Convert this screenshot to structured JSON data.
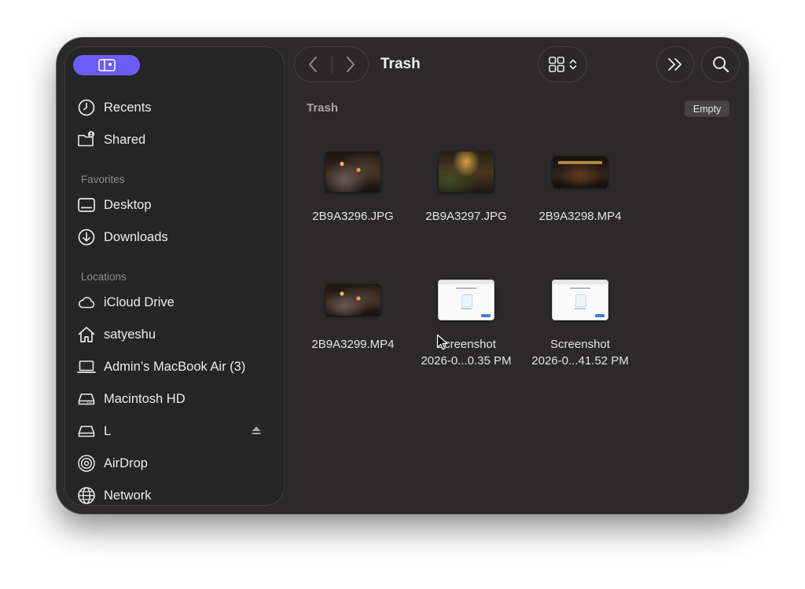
{
  "window": {
    "title": "Trash"
  },
  "sidebar": {
    "items": [
      {
        "label": "Recents",
        "icon": "clock-icon"
      },
      {
        "label": "Shared",
        "icon": "shared-folder-icon"
      }
    ],
    "favorites_title": "Favorites",
    "favorites": [
      {
        "label": "Desktop",
        "icon": "desktop-icon"
      },
      {
        "label": "Downloads",
        "icon": "download-icon"
      }
    ],
    "locations_title": "Locations",
    "locations": [
      {
        "label": "iCloud Drive",
        "icon": "cloud-icon"
      },
      {
        "label": "satyeshu",
        "icon": "home-icon"
      },
      {
        "label": "Admin’s MacBook Air (3)",
        "icon": "laptop-icon"
      },
      {
        "label": "Macintosh HD",
        "icon": "drive-icon"
      },
      {
        "label": "L",
        "icon": "drive-icon"
      },
      {
        "label": "AirDrop",
        "icon": "airdrop-icon"
      },
      {
        "label": "Network",
        "icon": "globe-icon"
      }
    ]
  },
  "content": {
    "header": "Trash",
    "empty_label": "Empty",
    "files": [
      {
        "name_line1": "2B9A3296.JPG",
        "name_line2": ""
      },
      {
        "name_line1": "2B9A3297.JPG",
        "name_line2": ""
      },
      {
        "name_line1": "2B9A3298.MP4",
        "name_line2": ""
      },
      {
        "name_line1": "2B9A3299.MP4",
        "name_line2": ""
      },
      {
        "name_line1": "Screenshot",
        "name_line2": "2026-0...0.35 PM"
      },
      {
        "name_line1": "Screenshot",
        "name_line2": "2026-0...41.52 PM"
      }
    ]
  },
  "colors": {
    "accent": "#6b5cf5",
    "window_bg": "#2b2929",
    "sidebar_bg": "#262525"
  }
}
